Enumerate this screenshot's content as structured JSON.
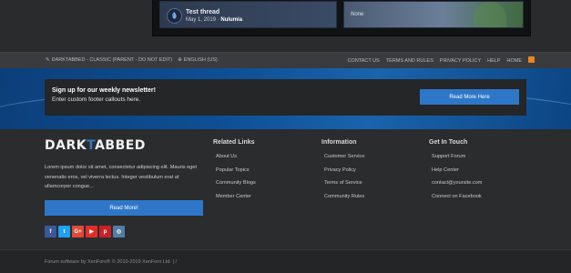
{
  "showcase": {
    "card1": {
      "title": "Test thread",
      "date": "May 1, 2019",
      "separator": " · ",
      "author": "Nulumia"
    },
    "card2": {
      "text": "None"
    }
  },
  "navbar": {
    "style": "DARKTABBED - CLASSIC (PARENT - DO NOT EDIT)",
    "language": "ENGLISH (US)",
    "links": [
      "CONTACT US",
      "TERMS AND RULES",
      "PRIVACY POLICY",
      "HELP",
      "HOME"
    ]
  },
  "newsletter": {
    "title": "Sign up for our weekly newsletter!",
    "subtitle": "Enter custom footer callouts here.",
    "button": "Read More Here"
  },
  "footer": {
    "logo_part1": "DARK",
    "logo_part2": "T",
    "logo_part3": "ABBED",
    "about": "Lorem ipsum dolor sit amet, consectetur adipiscing elit. Mauris eget venenatis eros, vel viverra lectus. Integer vestibulum erat at ullamcorper congue...",
    "read_more": "Read More!",
    "socials": [
      {
        "icon": "facebook-icon",
        "glyph": "f",
        "color": "#3b5998"
      },
      {
        "icon": "twitter-icon",
        "glyph": "t",
        "color": "#1da1f2"
      },
      {
        "icon": "google-plus-icon",
        "glyph": "G+",
        "color": "#dd4b39"
      },
      {
        "icon": "youtube-icon",
        "glyph": "▶",
        "color": "#e52d27"
      },
      {
        "icon": "pinterest-icon",
        "glyph": "p",
        "color": "#cb2027"
      },
      {
        "icon": "instagram-icon",
        "glyph": "◎",
        "color": "#517fa4"
      }
    ],
    "columns": [
      {
        "title": "Related Links",
        "items": [
          "About Us",
          "Popular Topics",
          "Community Blogs",
          "Member Center"
        ]
      },
      {
        "title": "Information",
        "items": [
          "Customer Service",
          "Privacy Policy",
          "Terms of Service",
          "Community Rules"
        ]
      },
      {
        "title": "Get In Touch",
        "items": [
          "Support Forum",
          "Help Center",
          "contact@yoursite.com",
          "Connect on Facebook"
        ]
      }
    ]
  },
  "copyright": "Forum software by XenForo® © 2010-2019 XenForo Ltd. | /",
  "colors": {
    "accent": "#2e77c8",
    "rss": "#e8871e"
  }
}
